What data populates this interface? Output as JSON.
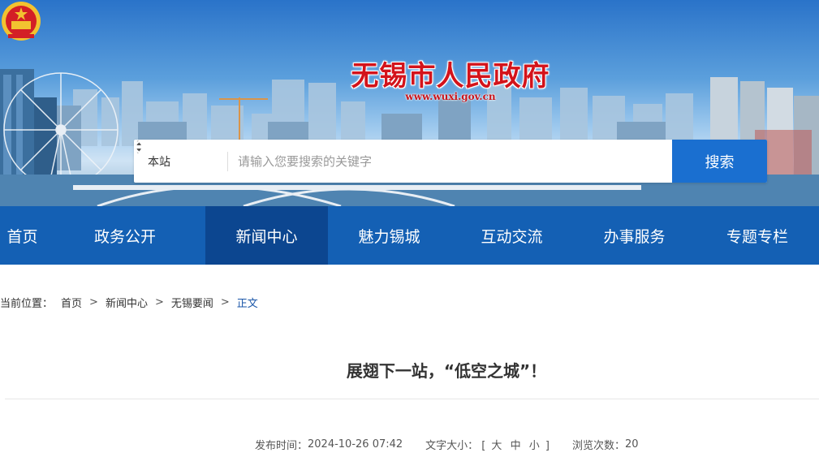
{
  "banner": {
    "title": "无锡市人民政府",
    "url": "www.wuxi.gov.cn"
  },
  "search": {
    "scope_label": "本站",
    "placeholder": "请输入您要搜索的关键字",
    "button_label": "搜索"
  },
  "nav": {
    "items": [
      {
        "label": "首页"
      },
      {
        "label": "政务公开"
      },
      {
        "label": "新闻中心"
      },
      {
        "label": "魅力锡城"
      },
      {
        "label": "互动交流"
      },
      {
        "label": "办事服务"
      },
      {
        "label": "专题专栏"
      }
    ],
    "active_index": 2
  },
  "breadcrumb": {
    "prefix": "当前位置：",
    "items": [
      "首页",
      "新闻中心",
      "无锡要闻",
      "正文"
    ],
    "separator": ">"
  },
  "article": {
    "title": "展翅下一站，“低空之城”！",
    "publish_label": "发布时间：",
    "publish_time": "2024-10-26 07:42",
    "font_size_label": "文字大小：",
    "font_size_open": "[",
    "font_size_large": "大",
    "font_size_medium": "中",
    "font_size_small": "小",
    "font_size_close": "]",
    "views_label": "浏览次数：",
    "views": "20"
  },
  "colors": {
    "nav_bg": "#1460b4",
    "nav_active": "#0c4690",
    "search_button": "#1a6fd0",
    "title_red": "#d3131b",
    "breadcrumb_current": "#1a56a8"
  },
  "icons": {
    "emblem": "national-emblem-icon",
    "scope_arrows": "updown-arrows-icon",
    "search": "search-icon"
  }
}
